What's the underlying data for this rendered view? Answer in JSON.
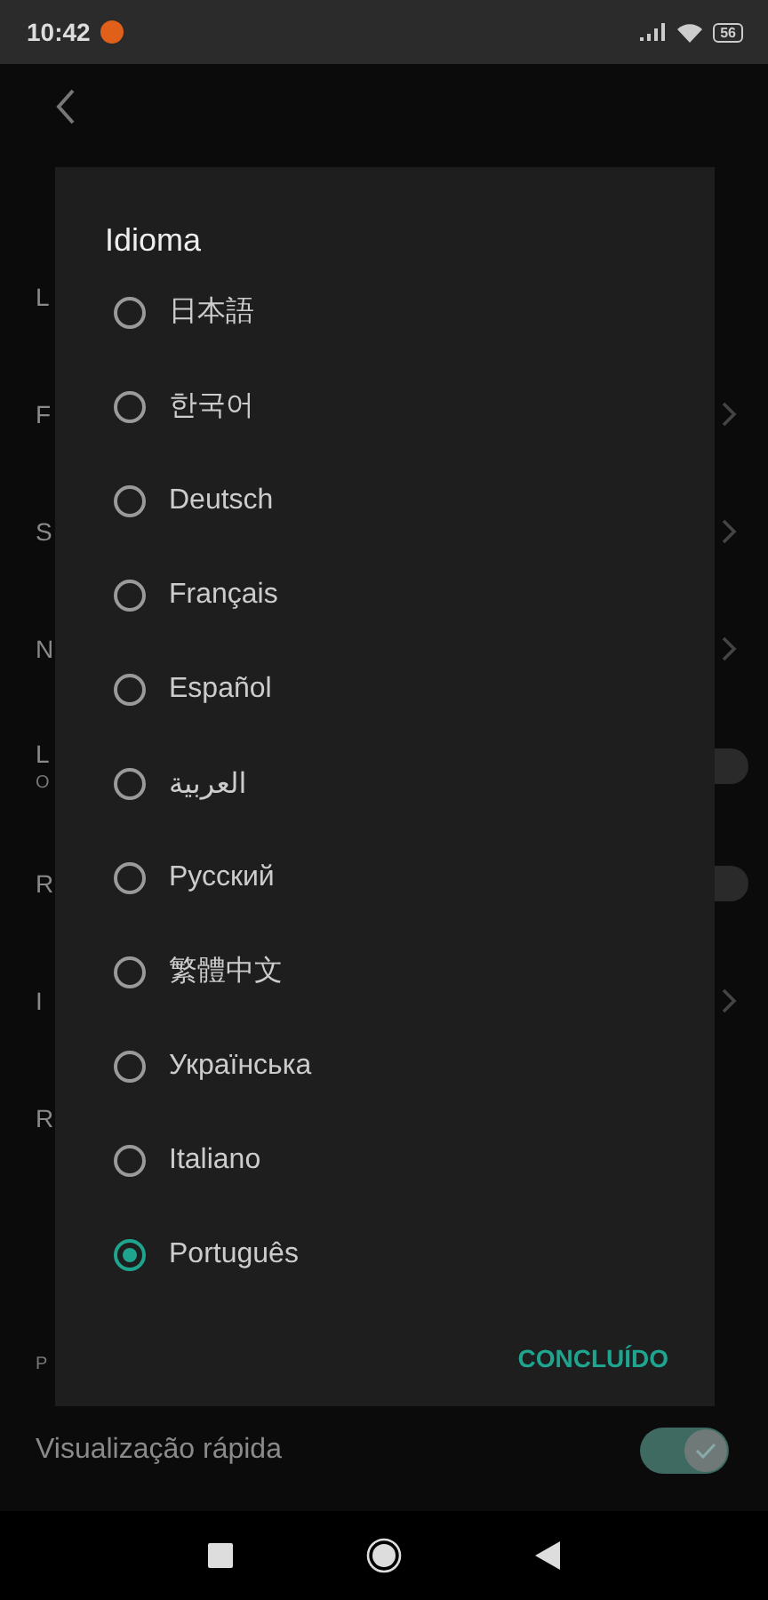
{
  "status_bar": {
    "time": "10:42",
    "battery": "56"
  },
  "background": {
    "rows": [
      {
        "label": "L",
        "kind": "plain"
      },
      {
        "label": "F",
        "kind": "chevron"
      },
      {
        "label": "S",
        "kind": "chevron"
      },
      {
        "label": "N",
        "kind": "chevron"
      },
      {
        "label": "L",
        "sublabel": "O",
        "kind": "switch",
        "on": false
      },
      {
        "label": "R",
        "kind": "switch",
        "on": false
      },
      {
        "label": "I",
        "kind": "chevron"
      },
      {
        "label": "R",
        "kind": "plain"
      }
    ],
    "section_subtitle": "P",
    "quick_view": {
      "label": "Visualização rápida",
      "on": true
    }
  },
  "dialog": {
    "title": "Idioma",
    "options": [
      {
        "label": "日本語",
        "selected": false
      },
      {
        "label": "한국어",
        "selected": false
      },
      {
        "label": "Deutsch",
        "selected": false
      },
      {
        "label": "Français",
        "selected": false
      },
      {
        "label": "Español",
        "selected": false
      },
      {
        "label": "العربية",
        "selected": false
      },
      {
        "label": "Русский",
        "selected": false
      },
      {
        "label": "繁體中文",
        "selected": false
      },
      {
        "label": "Українська",
        "selected": false
      },
      {
        "label": "Italiano",
        "selected": false
      },
      {
        "label": "Português",
        "selected": true
      }
    ],
    "button": "CONCLUÍDO"
  }
}
